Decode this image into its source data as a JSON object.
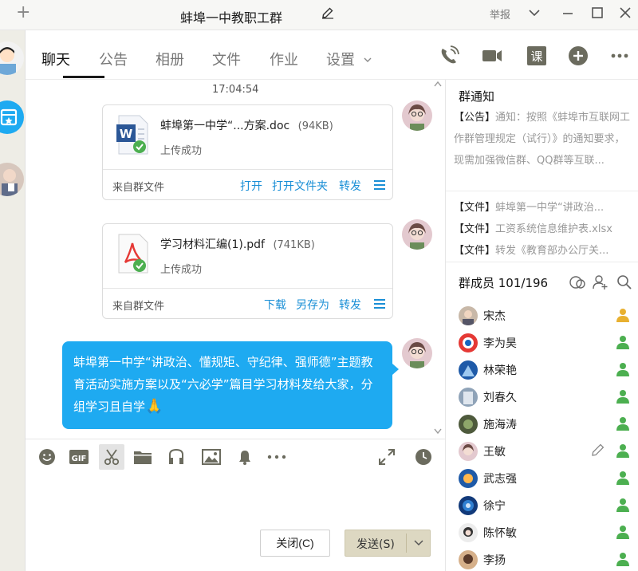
{
  "window": {
    "title": "蚌埠一中教职工群",
    "report_label": "举报"
  },
  "tabs": [
    {
      "label": "聊天",
      "active": true
    },
    {
      "label": "公告"
    },
    {
      "label": "相册"
    },
    {
      "label": "文件"
    },
    {
      "label": "作业"
    },
    {
      "label": "设置"
    }
  ],
  "tab_icons": [
    "phone-icon",
    "video-icon",
    "course-icon",
    "add-app-icon",
    "more-icon"
  ],
  "course_icon_label": "课",
  "chat": {
    "timestamp": "17:04:54",
    "files": [
      {
        "name": "蚌埠第一中学“...方案.doc",
        "size": "(94KB)",
        "status": "上传成功",
        "type": "word",
        "source": "来自群文件",
        "actions": [
          "打开",
          "打开文件夹",
          "转发"
        ]
      },
      {
        "name": "学习材料汇编(1).pdf",
        "size": "(741KB)",
        "status": "上传成功",
        "type": "pdf",
        "source": "来自群文件",
        "actions": [
          "下载",
          "另存为",
          "转发"
        ]
      }
    ],
    "message_text": "蚌埠第一中学“讲政治、懂规矩、守纪律、强师德”主题教育活动实施方案以及“六必学”篇目学习材料发给大家，分组学习且自学"
  },
  "toolbar_icons": [
    "emoji-icon",
    "gif-icon",
    "scissors-icon",
    "folder-icon",
    "music-icon",
    "image-icon",
    "bell-icon",
    "more-icon",
    "expand-icon",
    "history-icon"
  ],
  "input": {
    "close_label": "关闭(C)",
    "send_label": "发送(S)"
  },
  "group_notice": {
    "title": "群通知",
    "announcement_tag": "【公告】",
    "announcement_text": "通知：按照《蚌埠市互联网工作群管理规定（试行）》的通知要求，现需加强微信群、QQ群等互联...",
    "files": [
      {
        "tag": "【文件】",
        "text": "蚌埠第一中学“讲政治..."
      },
      {
        "tag": "【文件】",
        "text": "工资系统信息维护表.xlsx"
      },
      {
        "tag": "【文件】",
        "text": "转发《教育部办公厅关..."
      }
    ]
  },
  "members": {
    "header": "群成员 101/196",
    "list": [
      {
        "name": "宋杰",
        "role": "owner"
      },
      {
        "name": "李为昊",
        "role": "admin"
      },
      {
        "name": "林荣艳",
        "role": "admin"
      },
      {
        "name": "刘春久",
        "role": "admin"
      },
      {
        "name": "施海涛",
        "role": "admin"
      },
      {
        "name": "王敏",
        "role": "admin"
      },
      {
        "name": "武志强",
        "role": "admin"
      },
      {
        "name": "徐宁",
        "role": "admin"
      },
      {
        "name": "陈怀敏",
        "role": "admin"
      },
      {
        "name": "李扬",
        "role": "admin"
      }
    ]
  },
  "colors": {
    "bubble": "#1eaaf1",
    "link": "#1a8fd6",
    "owner_icon": "#e8b030",
    "admin_icon": "#4caf50",
    "toolbar_icon": "#6b6b5e"
  }
}
